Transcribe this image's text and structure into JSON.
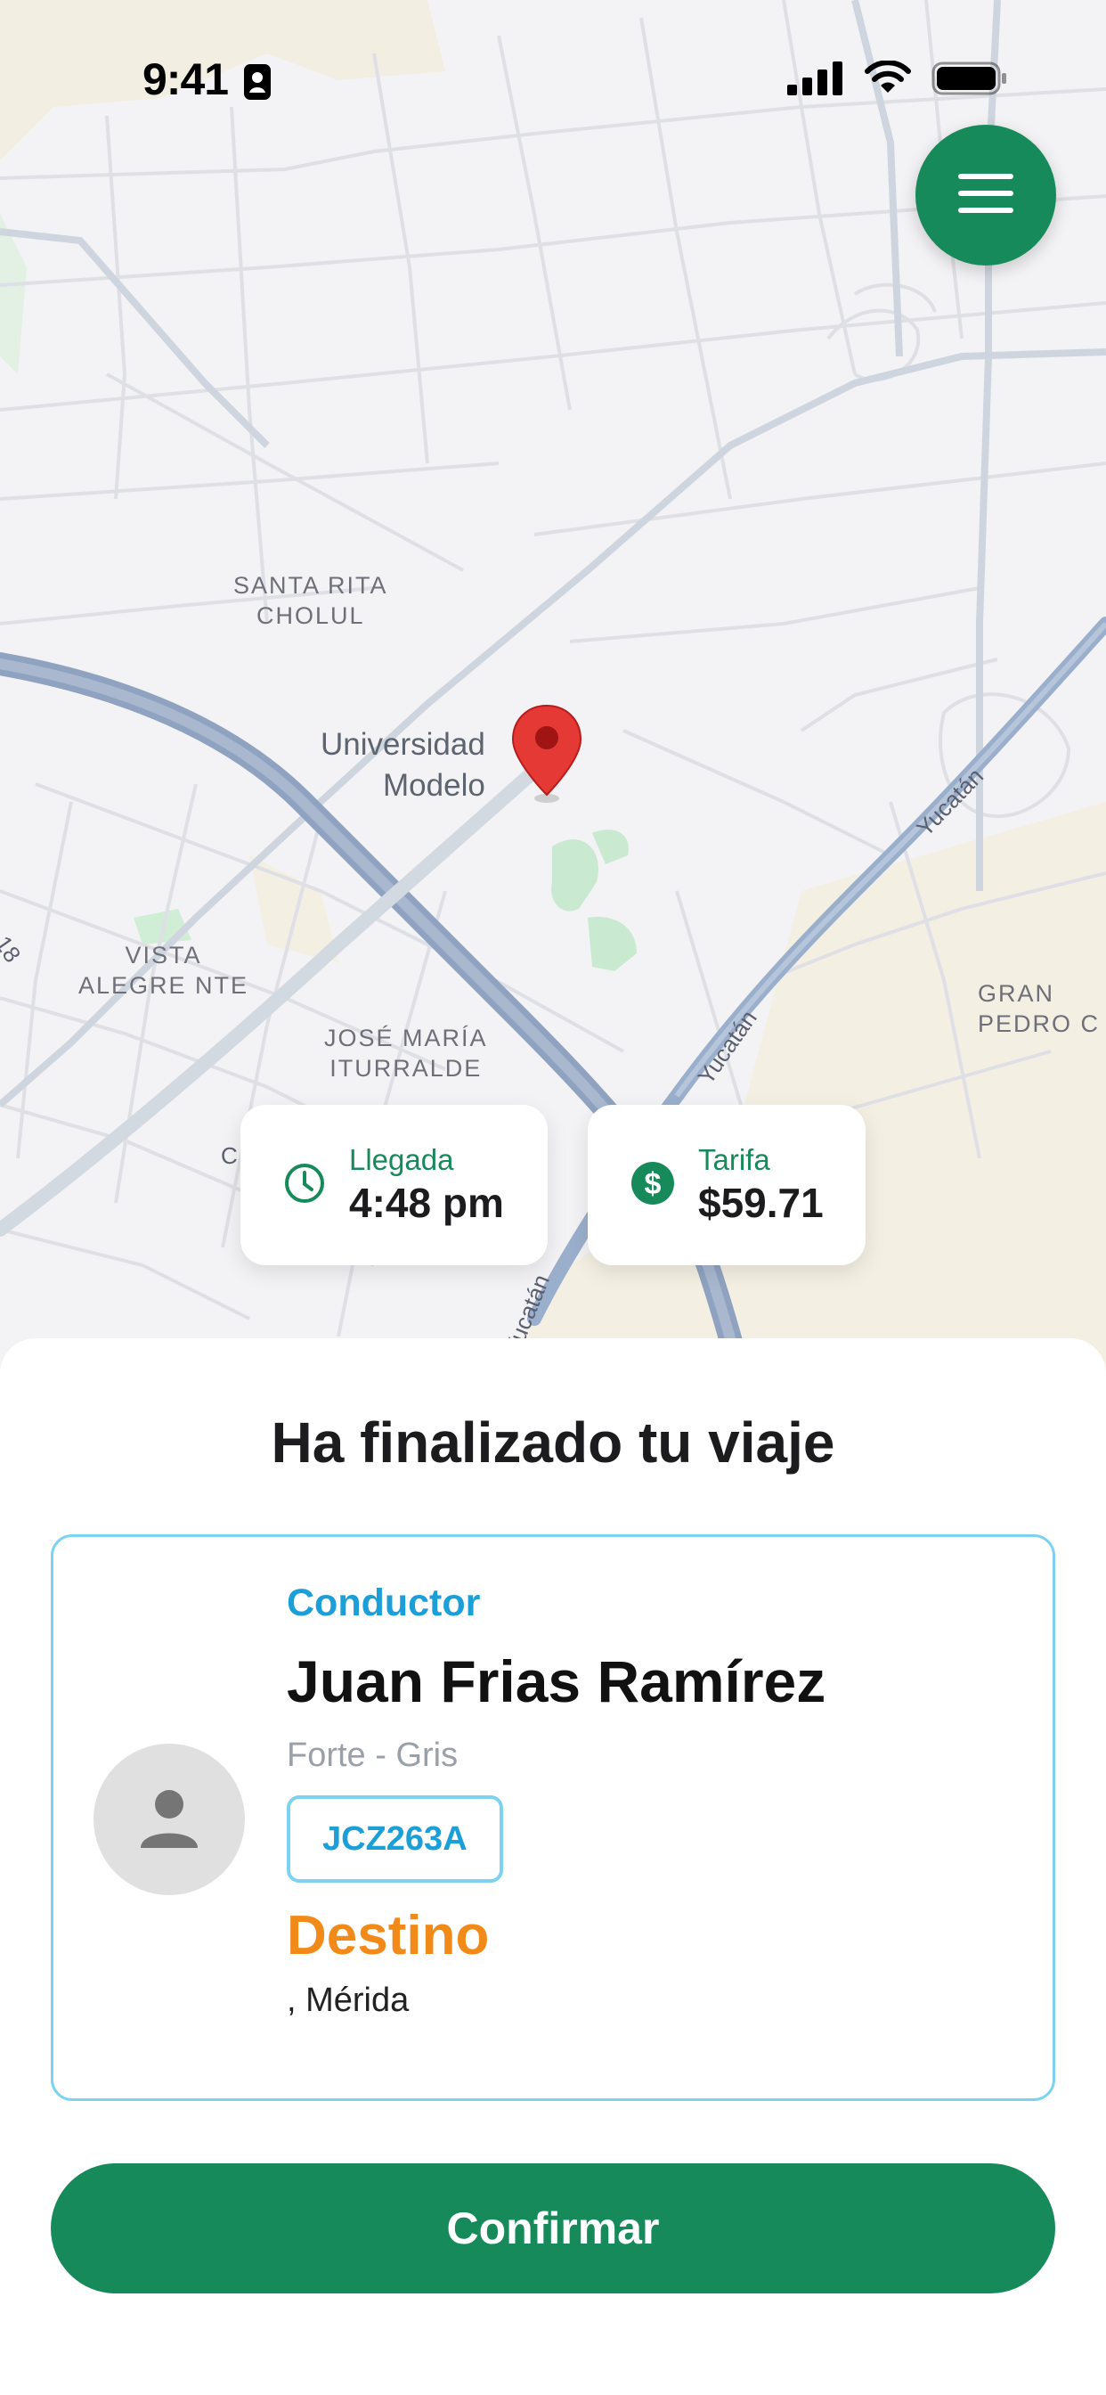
{
  "status_bar": {
    "time": "9:41"
  },
  "map": {
    "neighborhoods": [
      {
        "id": "santa-rita",
        "text": "SANTA RITA\nCHOLUL"
      },
      {
        "id": "vista-alegre",
        "text": "VISTA\nALEGRE NTE"
      },
      {
        "id": "jose-maria",
        "text": "JOSÉ MARÍA\nITURRALDE"
      },
      {
        "id": "gran-pedro",
        "text": "GRAN\nPEDRO C"
      }
    ],
    "poi_label": "Universidad\nModelo",
    "road_labels": [
      "Yucatán",
      "Yucatán",
      "Yucatán",
      "18",
      "C"
    ]
  },
  "arrival": {
    "label": "Llegada",
    "value": "4:48 pm"
  },
  "fare": {
    "label": "Tarifa",
    "value": "$59.71"
  },
  "sheet": {
    "title": "Ha finalizado tu viaje",
    "driver": {
      "role_label": "Conductor",
      "name": "Juan Frias Ramírez",
      "vehicle": "Forte - Gris",
      "plate": "JCZ263A"
    },
    "destination": {
      "label": "Destino",
      "value": ", Mérida"
    },
    "confirm_label": "Confirmar"
  },
  "colors": {
    "brand_green": "#178a5b",
    "accent_blue": "#1a9fd8",
    "destination_orange": "#f28a1a",
    "pin_red": "#e53935"
  },
  "icons": {
    "menu": "hamburger-menu-icon",
    "arrival": "clock-icon",
    "fare": "dollar-icon",
    "avatar": "person-icon",
    "pin": "map-pin-icon"
  }
}
